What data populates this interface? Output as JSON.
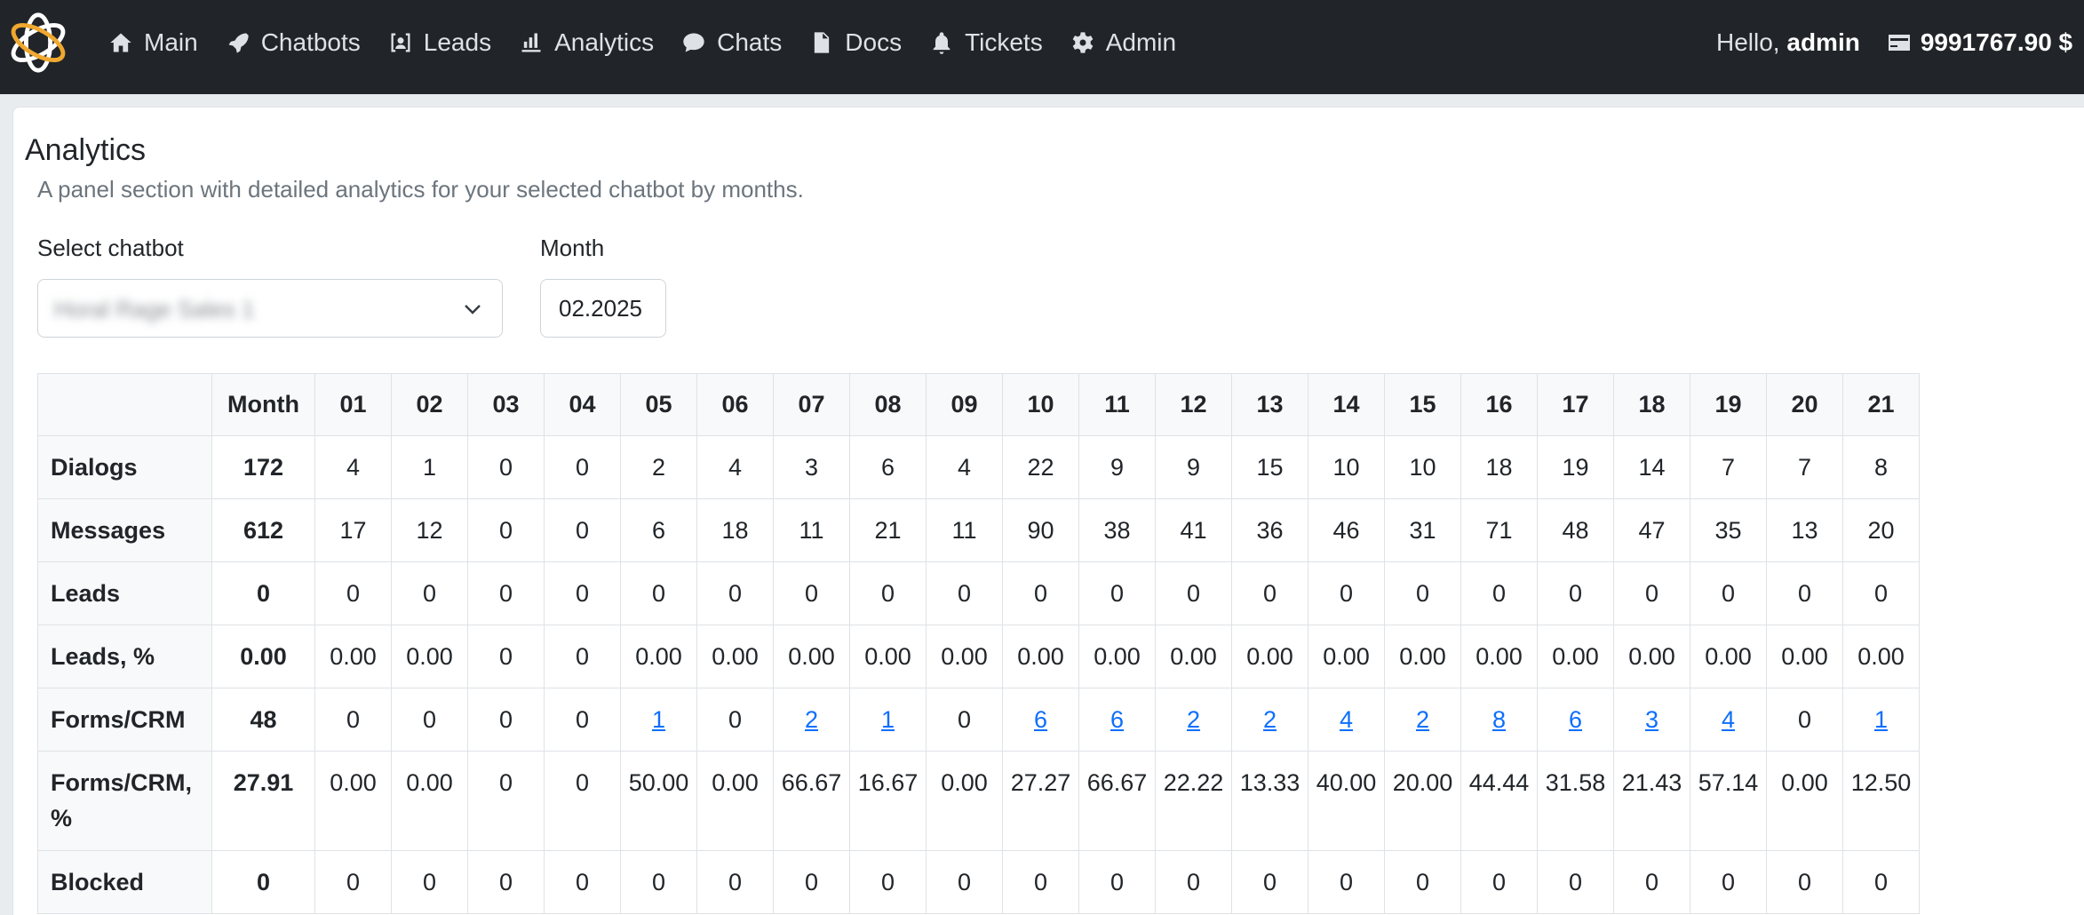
{
  "nav": {
    "items": [
      {
        "label": "Main",
        "icon": "home-icon"
      },
      {
        "label": "Chatbots",
        "icon": "rocket-icon"
      },
      {
        "label": "Leads",
        "icon": "user-badge-icon"
      },
      {
        "label": "Analytics",
        "icon": "bar-chart-icon"
      },
      {
        "label": "Chats",
        "icon": "chat-bubble-icon"
      },
      {
        "label": "Docs",
        "icon": "document-icon"
      },
      {
        "label": "Tickets",
        "icon": "bell-icon"
      },
      {
        "label": "Admin",
        "icon": "gear-icon"
      }
    ],
    "greeting": "Hello,",
    "username": "admin",
    "balance": "9991767.90 $"
  },
  "page": {
    "title": "Analytics",
    "subtitle": "A panel section with detailed analytics for your selected chatbot by months."
  },
  "filters": {
    "chatbot_label": "Select chatbot",
    "chatbot_value": "Horal Rage Sales 1",
    "month_label": "Month",
    "month_value": "02.2025"
  },
  "table": {
    "headers": [
      "",
      "Month",
      "01",
      "02",
      "03",
      "04",
      "05",
      "06",
      "07",
      "08",
      "09",
      "10",
      "11",
      "12",
      "13",
      "14",
      "15",
      "16",
      "17",
      "18",
      "19",
      "20",
      "21"
    ],
    "rows": [
      {
        "label": "Dialogs",
        "total": "172",
        "values": [
          "4",
          "1",
          "0",
          "0",
          "2",
          "4",
          "3",
          "6",
          "4",
          "22",
          "9",
          "9",
          "15",
          "10",
          "10",
          "18",
          "19",
          "14",
          "7",
          "7",
          "8"
        ]
      },
      {
        "label": "Messages",
        "total": "612",
        "values": [
          "17",
          "12",
          "0",
          "0",
          "6",
          "18",
          "11",
          "21",
          "11",
          "90",
          "38",
          "41",
          "36",
          "46",
          "31",
          "71",
          "48",
          "47",
          "35",
          "13",
          "20"
        ]
      },
      {
        "label": "Leads",
        "total": "0",
        "values": [
          "0",
          "0",
          "0",
          "0",
          "0",
          "0",
          "0",
          "0",
          "0",
          "0",
          "0",
          "0",
          "0",
          "0",
          "0",
          "0",
          "0",
          "0",
          "0",
          "0",
          "0"
        ]
      },
      {
        "label": "Leads, %",
        "total": "0.00",
        "values": [
          "0.00",
          "0.00",
          "0",
          "0",
          "0.00",
          "0.00",
          "0.00",
          "0.00",
          "0.00",
          "0.00",
          "0.00",
          "0.00",
          "0.00",
          "0.00",
          "0.00",
          "0.00",
          "0.00",
          "0.00",
          "0.00",
          "0.00",
          "0.00"
        ]
      },
      {
        "label": "Forms/CRM",
        "total": "48",
        "values": [
          "0",
          "0",
          "0",
          "0",
          "1",
          "0",
          "2",
          "1",
          "0",
          "6",
          "6",
          "2",
          "2",
          "4",
          "2",
          "8",
          "6",
          "3",
          "4",
          "0",
          "1"
        ],
        "links": [
          false,
          false,
          false,
          false,
          true,
          false,
          true,
          true,
          false,
          true,
          true,
          true,
          true,
          true,
          true,
          true,
          true,
          true,
          true,
          false,
          true
        ]
      },
      {
        "label": "Forms/CRM, %",
        "total": "27.91",
        "values": [
          "0.00",
          "0.00",
          "0",
          "0",
          "50.00",
          "0.00",
          "66.67",
          "16.67",
          "0.00",
          "27.27",
          "66.67",
          "22.22",
          "13.33",
          "40.00",
          "20.00",
          "44.44",
          "31.58",
          "21.43",
          "57.14",
          "0.00",
          "12.50"
        ]
      },
      {
        "label": "Blocked",
        "total": "0",
        "values": [
          "0",
          "0",
          "0",
          "0",
          "0",
          "0",
          "0",
          "0",
          "0",
          "0",
          "0",
          "0",
          "0",
          "0",
          "0",
          "0",
          "0",
          "0",
          "0",
          "0",
          "0"
        ]
      }
    ]
  }
}
